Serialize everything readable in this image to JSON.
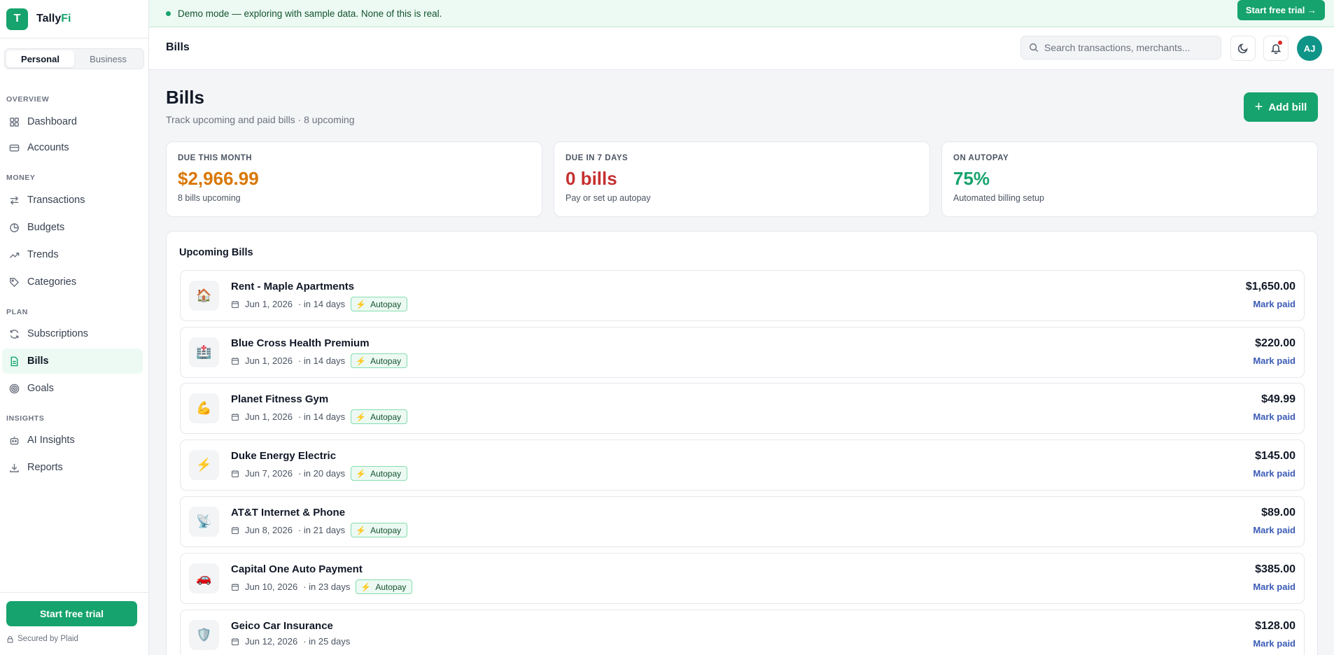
{
  "app": {
    "logo_letter": "T",
    "name_part1": "Tally",
    "name_part2": "Fi"
  },
  "mode_toggle": {
    "personal": "Personal",
    "business": "Business"
  },
  "sidebar": {
    "sections": {
      "overview": "OVERVIEW",
      "money": "MONEY",
      "plan": "PLAN",
      "insights": "INSIGHTS"
    },
    "items": [
      {
        "label": "Dashboard"
      },
      {
        "label": "Accounts"
      },
      {
        "label": "Transactions"
      },
      {
        "label": "Budgets"
      },
      {
        "label": "Trends"
      },
      {
        "label": "Categories"
      },
      {
        "label": "Subscriptions"
      },
      {
        "label": "Bills"
      },
      {
        "label": "Goals"
      },
      {
        "label": "AI Insights"
      },
      {
        "label": "Reports"
      }
    ],
    "trial_button": "Start free trial",
    "secured": "Secured by Plaid"
  },
  "banner": {
    "text": "Demo mode — exploring with sample data. None of this is real.",
    "button": "Start free trial →"
  },
  "header": {
    "title": "Bills",
    "search_placeholder": "Search transactions, merchants...",
    "avatar": "AJ"
  },
  "page": {
    "title": "Bills",
    "subtitle": "Track upcoming and paid bills · 8 upcoming",
    "add_button": "Add bill"
  },
  "stats": [
    {
      "label": "DUE THIS MONTH",
      "value": "$2,966.99",
      "note": "8 bills upcoming",
      "color": "#d97706"
    },
    {
      "label": "DUE IN 7 DAYS",
      "value": "0 bills",
      "note": "Pay or set up autopay",
      "color": "#c53030"
    },
    {
      "label": "ON AUTOPAY",
      "value": "75%",
      "note": "Automated billing setup",
      "color": "#16a36d"
    }
  ],
  "upcoming": {
    "title": "Upcoming Bills",
    "mark_paid": "Mark paid",
    "autopay_label": "Autopay",
    "bills": [
      {
        "icon": "🏠",
        "name": "Rent - Maple Apartments",
        "date": "Jun 1, 2026",
        "relative": "· in 14 days",
        "autopay": true,
        "amount": "$1,650.00"
      },
      {
        "icon": "🏥",
        "name": "Blue Cross Health Premium",
        "date": "Jun 1, 2026",
        "relative": "· in 14 days",
        "autopay": true,
        "amount": "$220.00"
      },
      {
        "icon": "💪",
        "name": "Planet Fitness Gym",
        "date": "Jun 1, 2026",
        "relative": "· in 14 days",
        "autopay": true,
        "amount": "$49.99"
      },
      {
        "icon": "⚡",
        "name": "Duke Energy Electric",
        "date": "Jun 7, 2026",
        "relative": "· in 20 days",
        "autopay": true,
        "amount": "$145.00"
      },
      {
        "icon": "📡",
        "name": "AT&T Internet & Phone",
        "date": "Jun 8, 2026",
        "relative": "· in 21 days",
        "autopay": true,
        "amount": "$89.00"
      },
      {
        "icon": "🚗",
        "name": "Capital One Auto Payment",
        "date": "Jun 10, 2026",
        "relative": "· in 23 days",
        "autopay": true,
        "amount": "$385.00"
      },
      {
        "icon": "🛡️",
        "name": "Geico Car Insurance",
        "date": "Jun 12, 2026",
        "relative": "· in 25 days",
        "autopay": false,
        "amount": "$128.00"
      }
    ]
  }
}
